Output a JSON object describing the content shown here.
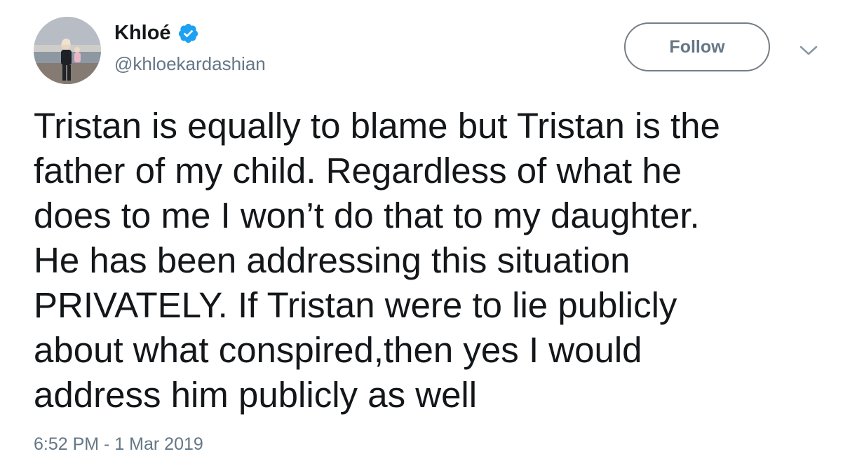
{
  "author": {
    "display_name": "Khloé",
    "handle": "@khloekardashian",
    "verified": true
  },
  "actions": {
    "follow_label": "Follow"
  },
  "tweet": {
    "lines": [
      "Tristan is equally to blame but Tristan is the",
      "father of my child. Regardless of what he",
      "does to me I won’t do that to my daughter.",
      "He has been addressing this situation",
      "PRIVATELY. If Tristan were to lie publicly",
      "about what conspired,then yes I would",
      "address him publicly as well"
    ],
    "timestamp": "6:52 PM - 1 Mar 2019"
  },
  "icons": {
    "verified": "verified-badge-icon",
    "menu": "chevron-down-icon"
  },
  "colors": {
    "verified_blue": "#1da1f2",
    "text": "#14171a",
    "secondary_text": "#657786",
    "button_border": "#767d84",
    "background": "#ffffff"
  }
}
